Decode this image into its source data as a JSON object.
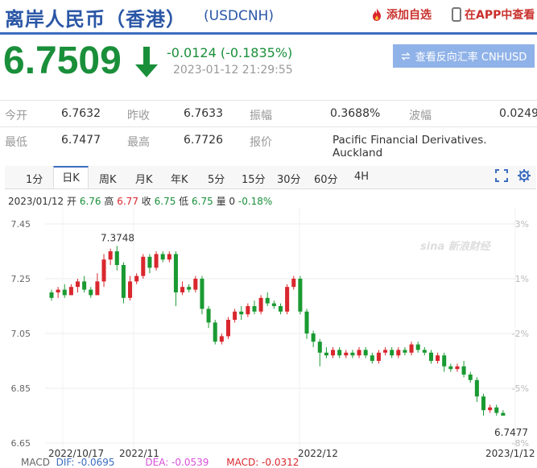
{
  "header": {
    "title": "离岸人民币（香港）",
    "symbol": "(USDCNH)",
    "add_watch": "添加自选",
    "app_view": "在APP中查看"
  },
  "quote": {
    "price": "6.7509",
    "change": "-0.0124 (-0.1835%)",
    "timestamp": "2023-01-12 21:29:55",
    "reverse_button": "查看反向汇率 CNHUSD"
  },
  "stats": {
    "row1": [
      {
        "label": "今开",
        "value": "6.7632"
      },
      {
        "label": "昨收",
        "value": "6.7633"
      },
      {
        "label": "振幅",
        "value": "0.3688%"
      },
      {
        "label": "波幅",
        "value": "0.0249"
      }
    ],
    "row2": [
      {
        "label": "最低",
        "value": "6.7477"
      },
      {
        "label": "最高",
        "value": "6.7726"
      },
      {
        "label": "报价",
        "value": "Pacific Financial Derivatives. Auckland"
      }
    ]
  },
  "tabs": [
    "1分",
    "日K",
    "周K",
    "月K",
    "年K",
    "5分",
    "15分",
    "30分",
    "60分",
    "4H"
  ],
  "active_tab": "日K",
  "kinfo": {
    "date": "2023/01/12",
    "open_label": "开",
    "open": "6.76",
    "high_label": "高",
    "high": "6.77",
    "close_label": "收",
    "close": "6.75",
    "low_label": "低",
    "low": "6.75",
    "vol_label": "量",
    "vol": "0",
    "pct": "-0.18%"
  },
  "colors": {
    "up": "#d9272e",
    "down": "#1a9a32",
    "accent": "#3c6dbf"
  },
  "chart_data": {
    "type": "candlestick",
    "y_ticks": [
      "7.45",
      "7.25",
      "7.05",
      "6.85",
      "6.65"
    ],
    "y_range": [
      6.65,
      7.45
    ],
    "right_ticks": [
      "3%",
      "1%",
      "-2%",
      "-5%",
      "-8%"
    ],
    "x_ticks": [
      "2022/10/17",
      "2022/11",
      "2022/12",
      "2023/1/12"
    ],
    "annotations": [
      {
        "text": "7.3748",
        "value": 7.3748
      },
      {
        "text": "6.7477",
        "value": 6.7477
      }
    ],
    "watermark": "sina 新浪财经",
    "candles": [
      [
        7.18,
        7.2,
        7.17,
        7.21,
        -1
      ],
      [
        7.2,
        7.21,
        7.18,
        7.22,
        1
      ],
      [
        7.21,
        7.19,
        7.18,
        7.23,
        -1
      ],
      [
        7.19,
        7.22,
        7.19,
        7.23,
        1
      ],
      [
        7.22,
        7.24,
        7.2,
        7.25,
        1
      ],
      [
        7.24,
        7.21,
        7.2,
        7.26,
        -1
      ],
      [
        7.21,
        7.19,
        7.18,
        7.22,
        -1
      ],
      [
        7.19,
        7.24,
        7.19,
        7.27,
        1
      ],
      [
        7.24,
        7.32,
        7.22,
        7.34,
        1
      ],
      [
        7.32,
        7.35,
        7.3,
        7.36,
        1
      ],
      [
        7.35,
        7.3,
        7.28,
        7.37,
        -1
      ],
      [
        7.3,
        7.18,
        7.16,
        7.31,
        -1
      ],
      [
        7.18,
        7.24,
        7.17,
        7.26,
        1
      ],
      [
        7.24,
        7.26,
        7.23,
        7.27,
        1
      ],
      [
        7.26,
        7.33,
        7.25,
        7.34,
        1
      ],
      [
        7.33,
        7.29,
        7.27,
        7.34,
        -1
      ],
      [
        7.29,
        7.34,
        7.28,
        7.35,
        1
      ],
      [
        7.34,
        7.32,
        7.31,
        7.35,
        -1
      ],
      [
        7.32,
        7.34,
        7.31,
        7.35,
        1
      ],
      [
        7.34,
        7.2,
        7.15,
        7.35,
        -1
      ],
      [
        7.2,
        7.22,
        7.19,
        7.24,
        1
      ],
      [
        7.22,
        7.21,
        7.2,
        7.23,
        -1
      ],
      [
        7.21,
        7.25,
        7.2,
        7.26,
        1
      ],
      [
        7.25,
        7.14,
        7.12,
        7.26,
        -1
      ],
      [
        7.14,
        7.09,
        7.07,
        7.15,
        -1
      ],
      [
        7.09,
        7.02,
        7.01,
        7.1,
        -1
      ],
      [
        7.02,
        7.04,
        7.01,
        7.05,
        1
      ],
      [
        7.04,
        7.1,
        7.03,
        7.11,
        1
      ],
      [
        7.1,
        7.13,
        7.09,
        7.14,
        1
      ],
      [
        7.13,
        7.12,
        7.1,
        7.15,
        -1
      ],
      [
        7.12,
        7.15,
        7.11,
        7.16,
        1
      ],
      [
        7.15,
        7.13,
        7.12,
        7.17,
        -1
      ],
      [
        7.13,
        7.18,
        7.12,
        7.19,
        1
      ],
      [
        7.18,
        7.16,
        7.15,
        7.2,
        -1
      ],
      [
        7.16,
        7.15,
        7.14,
        7.17,
        -1
      ],
      [
        7.15,
        7.13,
        7.12,
        7.16,
        -1
      ],
      [
        7.13,
        7.22,
        7.12,
        7.23,
        1
      ],
      [
        7.22,
        7.25,
        7.21,
        7.26,
        1
      ],
      [
        7.25,
        7.13,
        7.12,
        7.26,
        -1
      ],
      [
        7.13,
        7.05,
        7.03,
        7.14,
        -1
      ],
      [
        7.05,
        7.02,
        7.0,
        7.06,
        -1
      ],
      [
        7.02,
        6.98,
        6.93,
        7.03,
        -1
      ],
      [
        6.98,
        6.97,
        6.96,
        7.0,
        -1
      ],
      [
        6.97,
        6.99,
        6.96,
        7.0,
        1
      ],
      [
        6.99,
        6.97,
        6.96,
        7.0,
        -1
      ],
      [
        6.97,
        6.98,
        6.96,
        6.99,
        1
      ],
      [
        6.98,
        6.97,
        6.96,
        6.99,
        -1
      ],
      [
        6.97,
        6.99,
        6.96,
        7.0,
        1
      ],
      [
        6.99,
        6.97,
        6.96,
        7.0,
        -1
      ],
      [
        6.97,
        6.95,
        6.94,
        6.98,
        -1
      ],
      [
        6.95,
        6.98,
        6.94,
        6.99,
        1
      ],
      [
        6.98,
        6.99,
        6.97,
        7.0,
        1
      ],
      [
        6.99,
        6.97,
        6.96,
        7.0,
        -1
      ],
      [
        6.97,
        6.99,
        6.96,
        7.0,
        1
      ],
      [
        6.99,
        6.98,
        6.97,
        7.0,
        -1
      ],
      [
        6.98,
        7.01,
        6.97,
        7.02,
        1
      ],
      [
        7.01,
        6.99,
        6.98,
        7.02,
        -1
      ],
      [
        6.99,
        6.98,
        6.97,
        7.0,
        -1
      ],
      [
        6.98,
        6.95,
        6.94,
        6.99,
        -1
      ],
      [
        6.95,
        6.97,
        6.94,
        6.98,
        1
      ],
      [
        6.97,
        6.93,
        6.91,
        6.98,
        -1
      ],
      [
        6.93,
        6.92,
        6.91,
        6.94,
        -1
      ],
      [
        6.92,
        6.93,
        6.91,
        6.94,
        1
      ],
      [
        6.93,
        6.9,
        6.89,
        6.95,
        -1
      ],
      [
        6.9,
        6.88,
        6.87,
        6.91,
        -1
      ],
      [
        6.88,
        6.82,
        6.8,
        6.89,
        -1
      ],
      [
        6.82,
        6.77,
        6.75,
        6.83,
        -1
      ],
      [
        6.77,
        6.78,
        6.76,
        6.79,
        1
      ],
      [
        6.78,
        6.76,
        6.75,
        6.79,
        -1
      ],
      [
        6.76,
        6.75,
        6.75,
        6.77,
        -1
      ]
    ]
  }
}
